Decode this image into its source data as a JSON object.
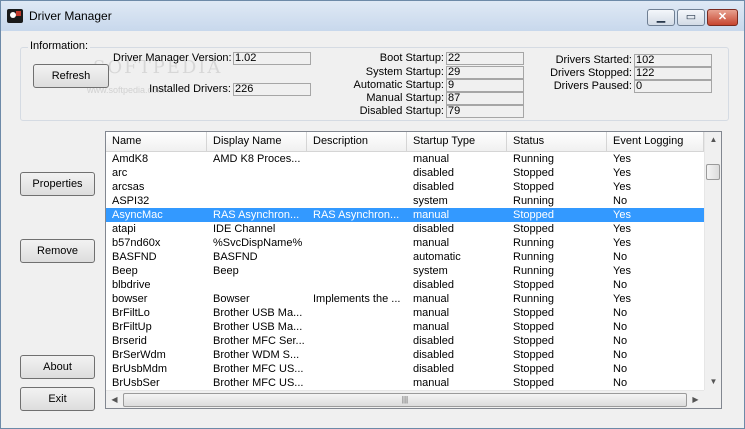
{
  "window": {
    "title": "Driver Manager"
  },
  "info": {
    "group_label": "Information:",
    "refresh_label": "Refresh",
    "version_label": "Driver Manager Version:",
    "version_value": "1.02",
    "installed_label": "Installed Drivers:",
    "installed_value": "226",
    "boot_label": "Boot Startup:",
    "boot_value": "22",
    "system_label": "System Startup:",
    "system_value": "29",
    "automatic_label": "Automatic Startup:",
    "automatic_value": "9",
    "manual_label": "Manual Startup:",
    "manual_value": "87",
    "disabled_label": "Disabled Startup:",
    "disabled_value": "79",
    "started_label": "Drivers Started:",
    "started_value": "102",
    "stopped_label": "Drivers Stopped:",
    "stopped_value": "122",
    "paused_label": "Drivers Paused:",
    "paused_value": "0"
  },
  "watermark": {
    "main": "SOFTPEDIA",
    "sub": "www.softpedia.com"
  },
  "buttons": {
    "properties": "Properties",
    "remove": "Remove",
    "about": "About",
    "exit": "Exit"
  },
  "columns": [
    "Name",
    "Display Name",
    "Description",
    "Startup Type",
    "Status",
    "Event Logging"
  ],
  "selected_index": 4,
  "rows": [
    [
      "AmdK8",
      "AMD K8 Proces...",
      "",
      "manual",
      "Running",
      "Yes"
    ],
    [
      "arc",
      "",
      "",
      "disabled",
      "Stopped",
      "Yes"
    ],
    [
      "arcsas",
      "",
      "",
      "disabled",
      "Stopped",
      "Yes"
    ],
    [
      "ASPI32",
      "",
      "",
      "system",
      "Running",
      "No"
    ],
    [
      "AsyncMac",
      "RAS Asynchron...",
      "RAS Asynchron...",
      "manual",
      "Stopped",
      "Yes"
    ],
    [
      "atapi",
      "IDE Channel",
      "",
      "disabled",
      "Stopped",
      "Yes"
    ],
    [
      "b57nd60x",
      "%SvcDispName%",
      "",
      "manual",
      "Running",
      "Yes"
    ],
    [
      "BASFND",
      "BASFND",
      "",
      "automatic",
      "Running",
      "No"
    ],
    [
      "Beep",
      "Beep",
      "",
      "system",
      "Running",
      "Yes"
    ],
    [
      "blbdrive",
      "",
      "",
      "disabled",
      "Stopped",
      "No"
    ],
    [
      "bowser",
      "Bowser",
      "Implements the ...",
      "manual",
      "Running",
      "Yes"
    ],
    [
      "BrFiltLo",
      "Brother USB Ma...",
      "",
      "manual",
      "Stopped",
      "No"
    ],
    [
      "BrFiltUp",
      "Brother USB Ma...",
      "",
      "manual",
      "Stopped",
      "No"
    ],
    [
      "Brserid",
      "Brother MFC Ser...",
      "",
      "disabled",
      "Stopped",
      "No"
    ],
    [
      "BrSerWdm",
      "Brother WDM S...",
      "",
      "disabled",
      "Stopped",
      "No"
    ],
    [
      "BrUsbMdm",
      "Brother MFC US...",
      "",
      "disabled",
      "Stopped",
      "No"
    ],
    [
      "BrUsbSer",
      "Brother MFC US...",
      "",
      "manual",
      "Stopped",
      "No"
    ]
  ]
}
